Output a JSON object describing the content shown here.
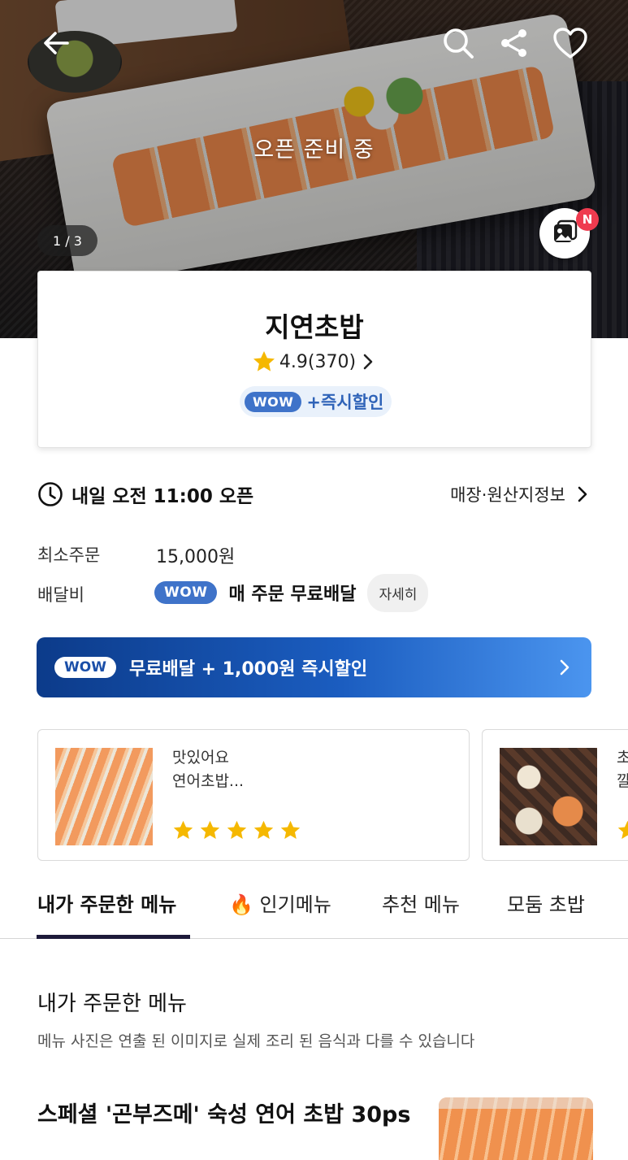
{
  "hero": {
    "status": "오픈 준비 중",
    "page_counter": "1 / 3",
    "new_badge": "N"
  },
  "store": {
    "name": "지연초밥",
    "rating": "4.9(370)",
    "wow_label": "WOW",
    "instant_discount": "+즉시할인"
  },
  "open_info": {
    "hours": "내일 오전 11:00 오픈",
    "store_info_link": "매장·원산지정보"
  },
  "min_order": {
    "label": "최소주문",
    "value": "15,000원"
  },
  "delivery_fee": {
    "label": "배달비",
    "wow_label": "WOW",
    "value": "매 주문 무료배달",
    "detail_button": "자세히"
  },
  "banner": {
    "wow_label": "WOW",
    "text": "무료배달 + 1,000원 즉시할인"
  },
  "reviews": [
    {
      "text_line1": "맛있어요",
      "text_line2": "연어초밥...",
      "stars": 5
    },
    {
      "text_line1": "초",
      "text_line2": "깔"
    }
  ],
  "tabs": [
    {
      "label": "내가 주문한 메뉴",
      "active": true
    },
    {
      "label": "🔥 인기메뉴",
      "active": false
    },
    {
      "label": "추천 메뉴",
      "active": false
    },
    {
      "label": "모둠 초밥",
      "active": false
    }
  ],
  "section": {
    "title": "내가 주문한 메뉴",
    "note": "메뉴 사진은 연출 된 이미지로 실제 조리 된 음식과 다를 수 있습니다"
  },
  "menu_item": {
    "name": "스페셜 '곤부즈메' 숙성 연어 초밥 30ps"
  },
  "colors": {
    "wow_blue": "#3f73c9",
    "banner_start": "#0c3b8a",
    "banner_end": "#4b95ef",
    "star": "#f5b800",
    "tab_indicator": "#1d1a3a",
    "new_badge": "#ef3b4f"
  },
  "icons": [
    "back-arrow-icon",
    "search-icon",
    "share-icon",
    "heart-icon",
    "photo-review-icon",
    "star-icon",
    "chevron-right-icon",
    "clock-icon",
    "fire-icon"
  ]
}
